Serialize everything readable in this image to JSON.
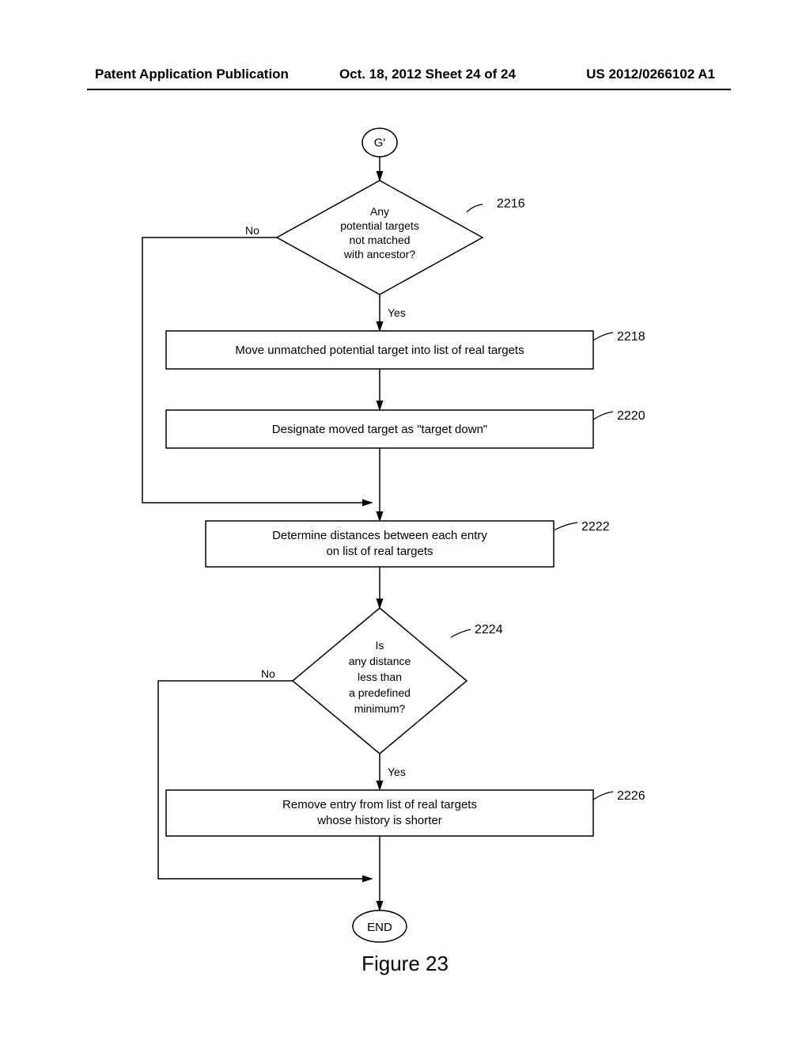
{
  "header": {
    "left": "Patent Application Publication",
    "mid": "Oct. 18, 2012   Sheet 24 of 24",
    "right": "US 2012/0266102 A1"
  },
  "nodes": {
    "start": "G'",
    "d2216_l1": "Any",
    "d2216_l2": "potential targets",
    "d2216_l3": "not matched",
    "d2216_l4": "with ancestor?",
    "b2218": "Move unmatched potential target into list of real targets",
    "b2220": "Designate moved target as \"target down\"",
    "b2222_l1": "Determine distances between each entry",
    "b2222_l2": "on list of real targets",
    "d2224_l1": "Is",
    "d2224_l2": "any distance",
    "d2224_l3": "less than",
    "d2224_l4": "a predefined",
    "d2224_l5": "minimum?",
    "b2226_l1": "Remove entry from list of real targets",
    "b2226_l2": "whose history is shorter",
    "end": "END"
  },
  "labels": {
    "ref2216": "2216",
    "ref2218": "2218",
    "ref2220": "2220",
    "ref2222": "2222",
    "ref2224": "2224",
    "ref2226": "2226",
    "yes1": "Yes",
    "no1": "No",
    "yes2": "Yes",
    "no2": "No"
  },
  "caption": "Figure 23"
}
